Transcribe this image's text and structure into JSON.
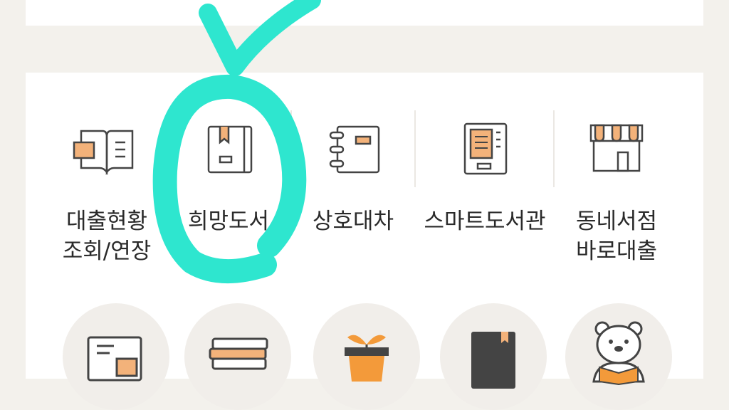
{
  "menu": {
    "items": [
      {
        "label": "대출현황\n조회/연장",
        "icon": "open-book-icon"
      },
      {
        "label": "희망도서",
        "icon": "bookmarked-book-icon"
      },
      {
        "label": "상호대차",
        "icon": "spiral-notebook-icon"
      },
      {
        "label": "스마트도서관",
        "icon": "book-kiosk-icon"
      },
      {
        "label": "동네서점\n바로대출",
        "icon": "storefront-icon"
      }
    ]
  },
  "shortcuts": {
    "items": [
      {
        "icon": "laptop-icon"
      },
      {
        "icon": "book-stack-icon"
      },
      {
        "icon": "potted-sprout-icon"
      },
      {
        "icon": "closed-book-icon"
      },
      {
        "icon": "bear-reading-icon"
      }
    ]
  },
  "colors": {
    "accent": "#f3b27a",
    "icon_stroke": "#444444",
    "annotation": "#2ee6cf",
    "background": "#f3f1ec"
  }
}
